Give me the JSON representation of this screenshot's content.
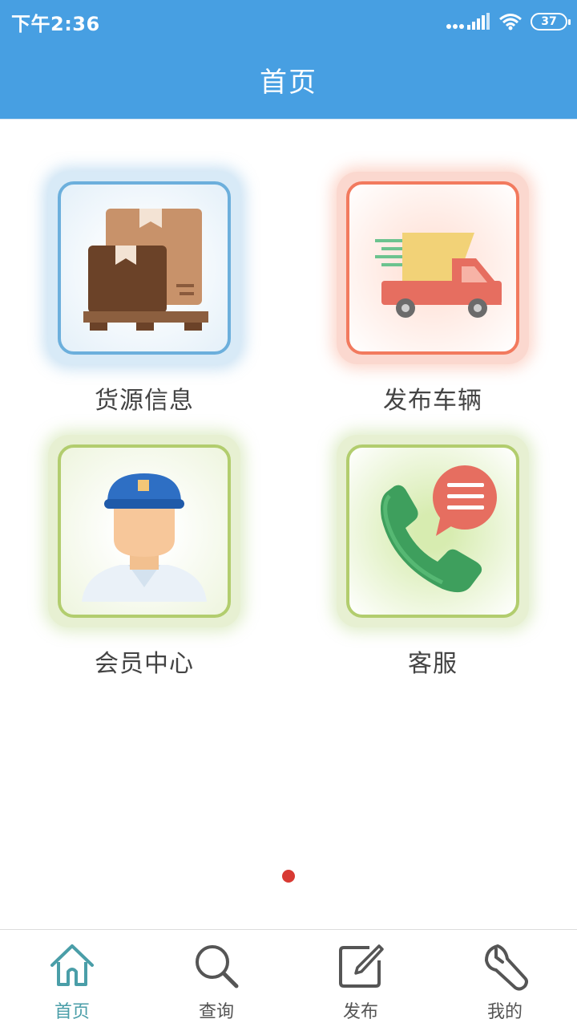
{
  "status_bar": {
    "time": "下午2:36",
    "battery": "37",
    "icons": [
      "signal-icon",
      "wifi-icon",
      "battery-icon"
    ]
  },
  "header": {
    "title": "首页"
  },
  "tiles": [
    {
      "label": "货源信息",
      "icon": "cargo-boxes-icon",
      "accent": "#6cafdc"
    },
    {
      "label": "发布车辆",
      "icon": "delivery-truck-icon",
      "accent": "#f27a5e"
    },
    {
      "label": "会员中心",
      "icon": "member-avatar-icon",
      "accent": "#b2cd6e"
    },
    {
      "label": "客服",
      "icon": "phone-chat-icon",
      "accent": "#b2cd6e"
    }
  ],
  "pager": {
    "active_color": "#d83a33"
  },
  "bottom_nav": {
    "active_color": "#4a9ea8",
    "items": [
      {
        "label": "首页",
        "icon": "home-icon"
      },
      {
        "label": "查询",
        "icon": "search-icon"
      },
      {
        "label": "发布",
        "icon": "edit-icon"
      },
      {
        "label": "我的",
        "icon": "wrench-icon"
      }
    ]
  }
}
